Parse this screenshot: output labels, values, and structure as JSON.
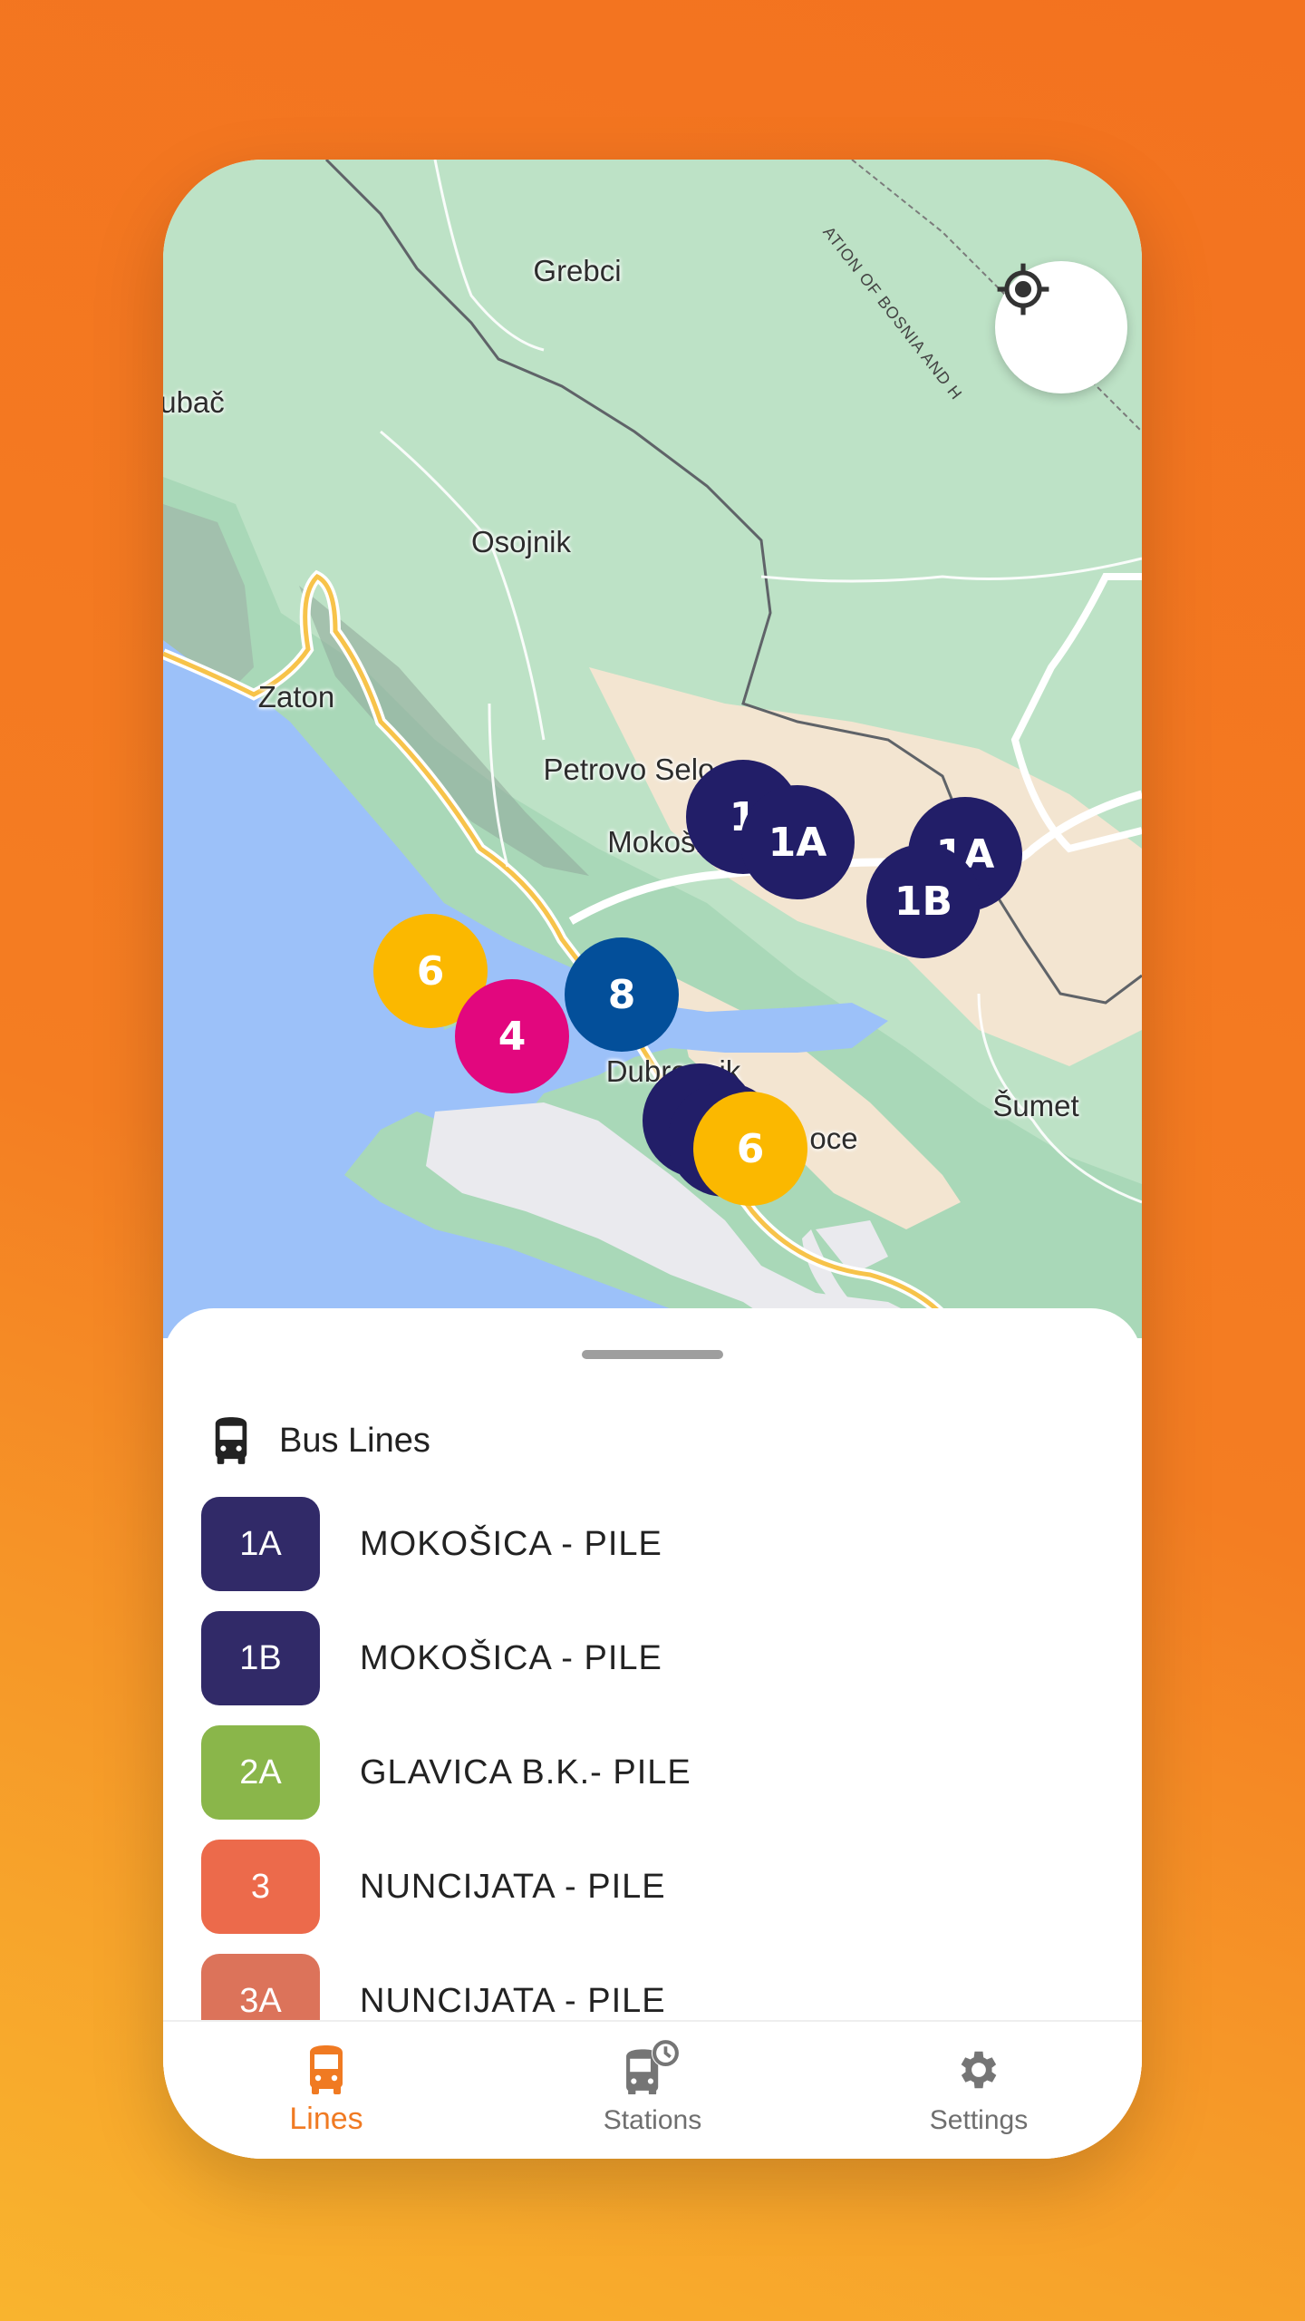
{
  "map": {
    "labels": {
      "grebci": "Grebci",
      "ubac": "ubač",
      "osojnik": "Osojnik",
      "zaton": "Zaton",
      "petrovo_selo": "Petrovo Selo",
      "mokosica": "Mokošica",
      "dubrovnik": "Dubrovnik",
      "sumet": "Šumet",
      "ploce": "oce",
      "border": "ATION OF BOSNIA AND H"
    },
    "locate_icon": "my-location-icon",
    "markers": [
      {
        "label": "1",
        "color": "#221e68"
      },
      {
        "label": "1A",
        "color": "#221e68"
      },
      {
        "label": "1A",
        "color": "#221e68"
      },
      {
        "label": "1B",
        "color": "#221e68"
      },
      {
        "label": "6",
        "color": "#fbb800"
      },
      {
        "label": "4",
        "color": "#e2077e"
      },
      {
        "label": "8",
        "color": "#034f9a"
      },
      {
        "label": "",
        "color": "#221e68"
      },
      {
        "label": "",
        "color": "#221e68"
      },
      {
        "label": "6",
        "color": "#fbb800"
      }
    ]
  },
  "sheet": {
    "title": "Bus Lines",
    "title_icon": "bus-icon",
    "lines": [
      {
        "code": "1A",
        "name": "MOKOŠICA - PILE",
        "color": "#312a68"
      },
      {
        "code": "1B",
        "name": "MOKOŠICA - PILE",
        "color": "#312a68"
      },
      {
        "code": "2A",
        "name": "GLAVICA B.K.- PILE",
        "color": "#8ab64a"
      },
      {
        "code": "3",
        "name": "NUNCIJATA - PILE",
        "color": "#ec6a4b"
      },
      {
        "code": "3A",
        "name": "NUNCIJATA - PILE",
        "color": "#dc735a"
      }
    ]
  },
  "nav": {
    "items": [
      {
        "label": "Lines",
        "icon": "bus-icon",
        "active": true
      },
      {
        "label": "Stations",
        "icon": "bus-clock-icon",
        "active": false
      },
      {
        "label": "Settings",
        "icon": "gear-icon",
        "active": false
      }
    ],
    "accent": "#f07a22"
  }
}
